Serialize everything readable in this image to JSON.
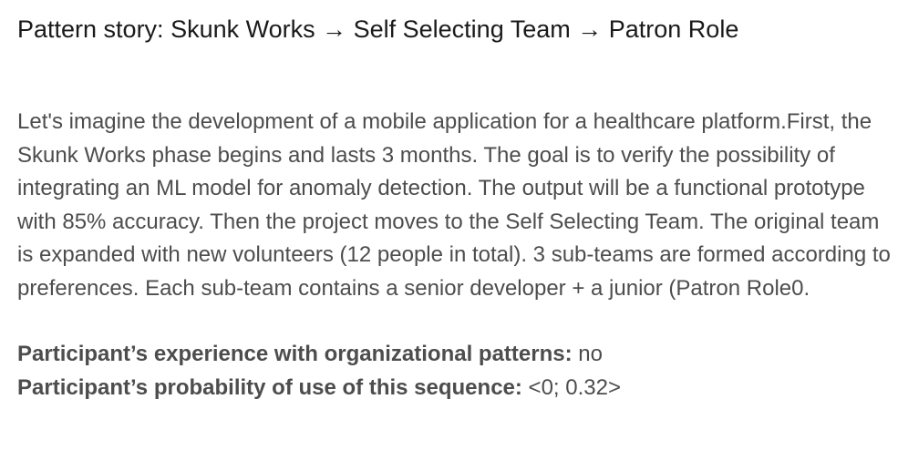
{
  "document": {
    "title": "Pattern story: Skunk Works → Self Selecting Team → Patron Role",
    "story": "Let's imagine the development of a mobile application for a healthcare platform.First, the Skunk Works phase begins and lasts 3 months. The goal is to verify the possibility of integrating an ML model for anomaly detection. The output will be a functional prototype with 85% accuracy. Then the project moves to the Self Selecting Team. The original team is expanded with new volunteers (12 people in total). 3 sub-teams are formed according to preferences. Each sub-team contains a senior developer + a junior (Patron Role0.",
    "experience": {
      "label": "Participant’s experience with organizational patterns:",
      "value": "no"
    },
    "probability": {
      "label": "Participant’s probability of use of this sequence:",
      "value": "<0; 0.32>"
    }
  }
}
